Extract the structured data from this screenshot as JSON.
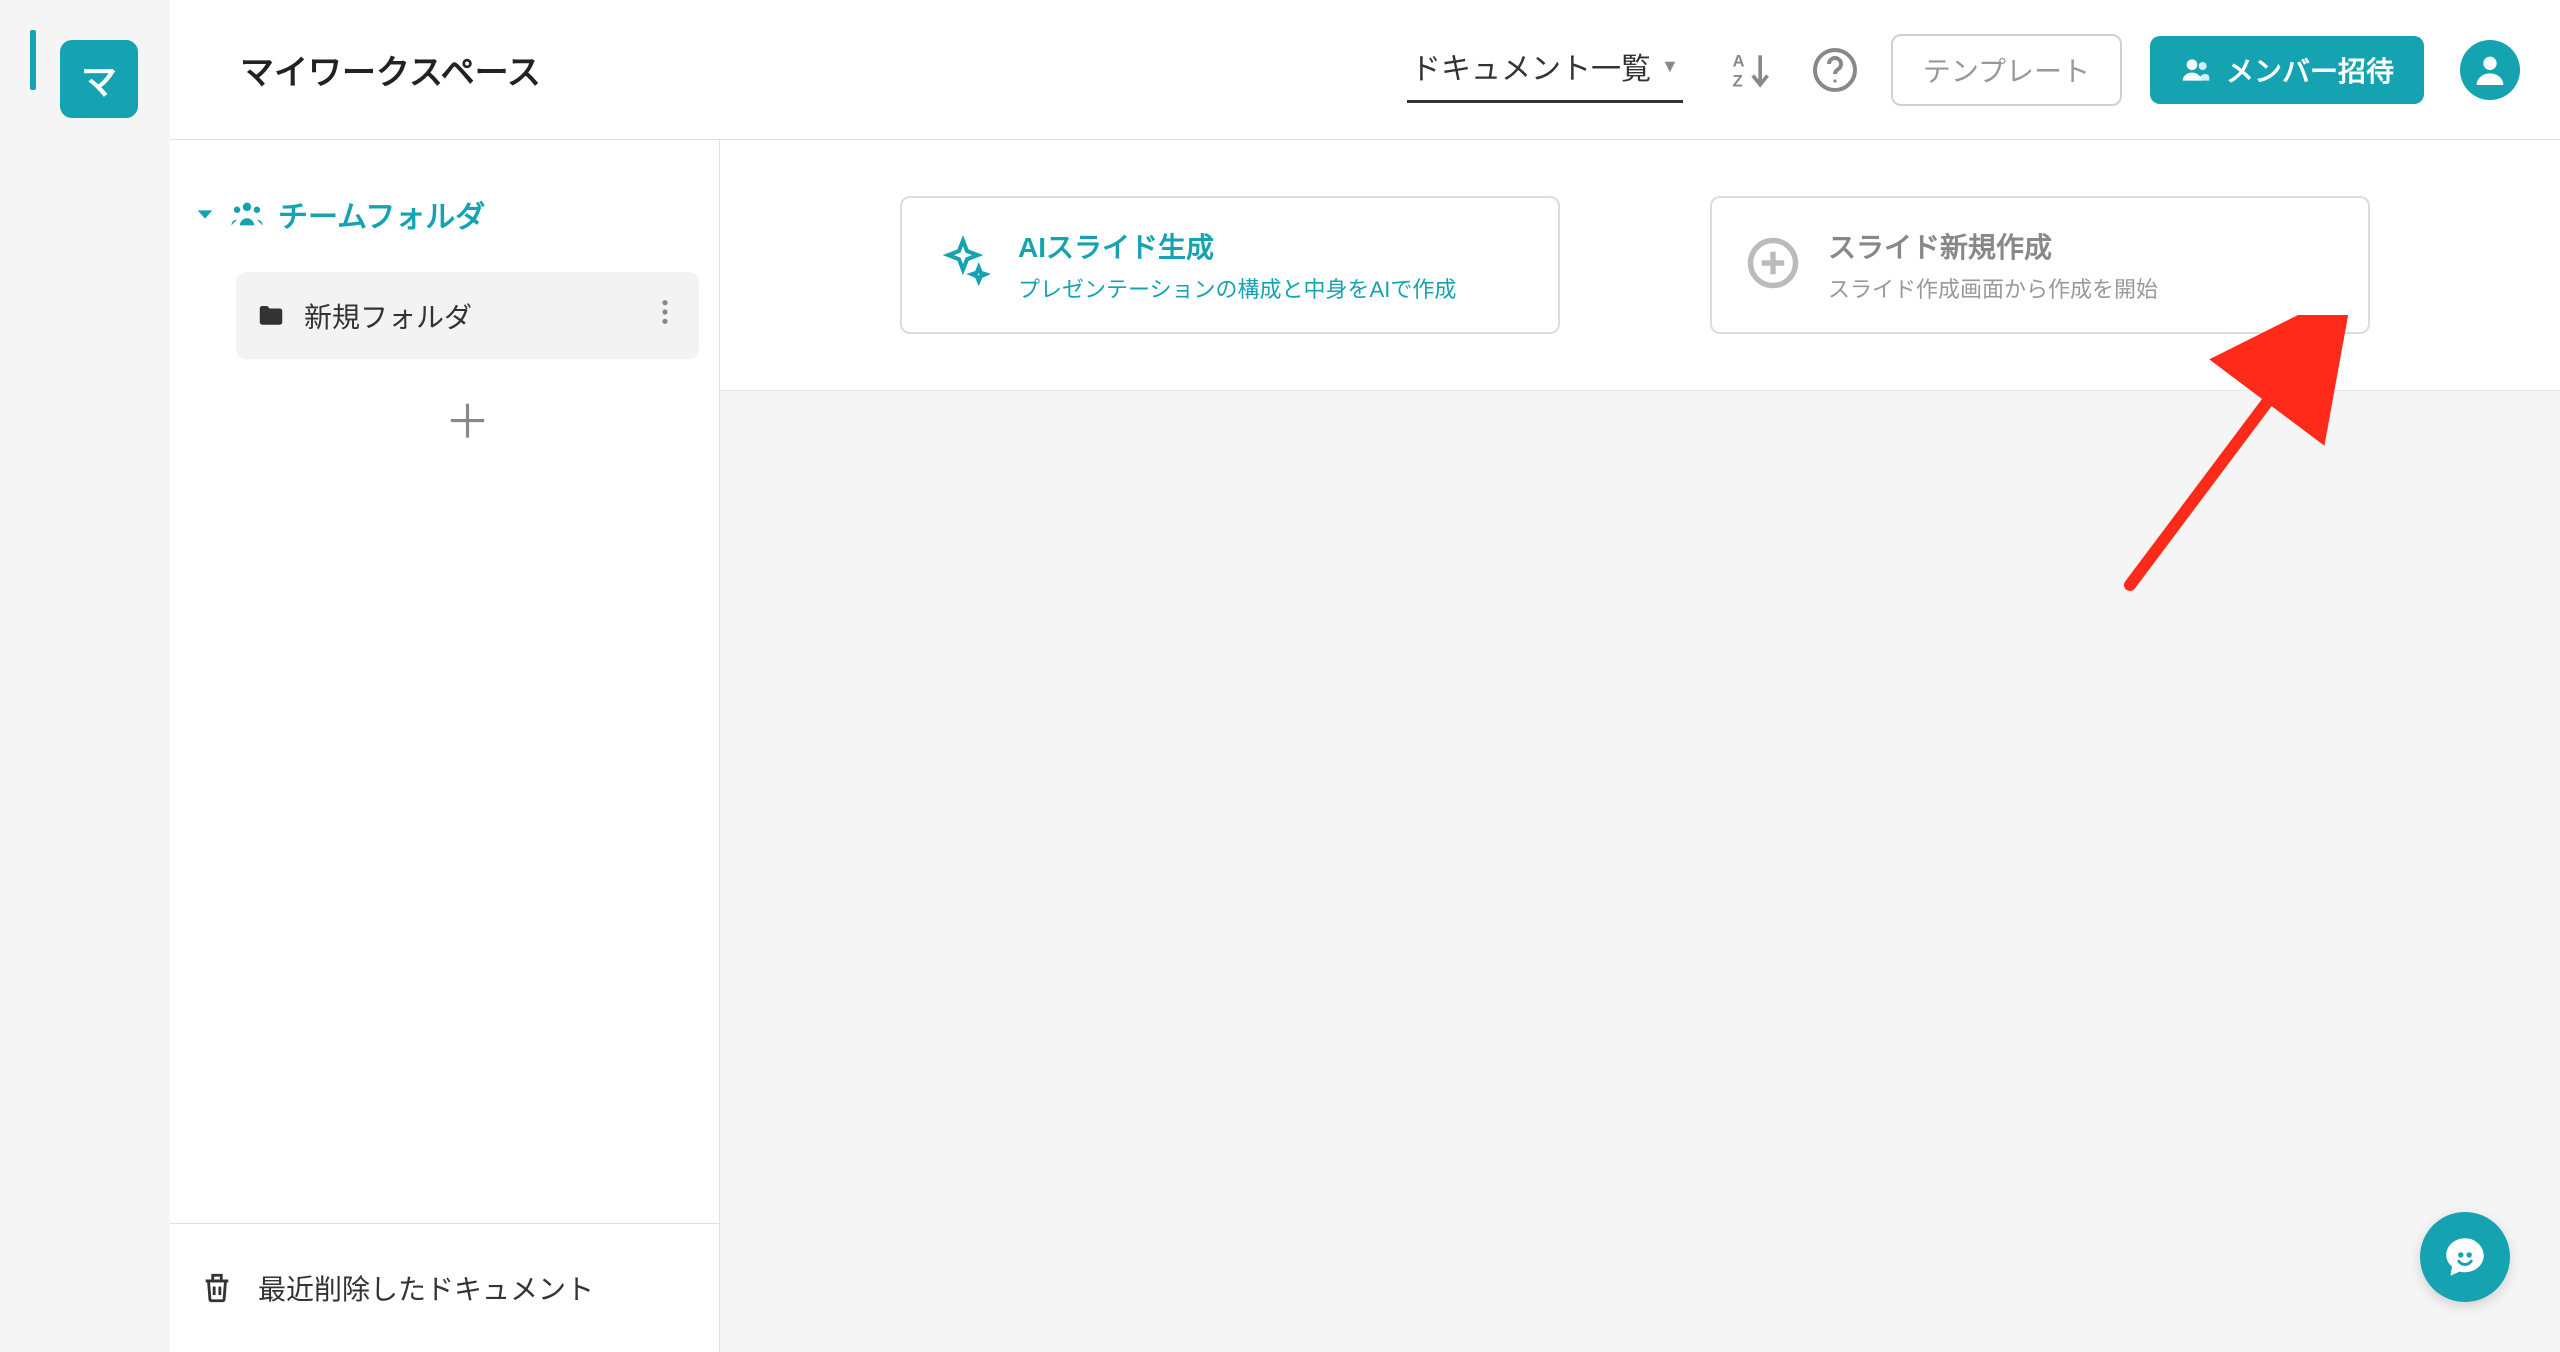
{
  "leftRail": {
    "workspace_badge_text": "マ"
  },
  "topbar": {
    "page_title": "マイワークスペース",
    "document_list_label": "ドキュメント一覧",
    "template_button_label": "テンプレート",
    "invite_button_label": "メンバー招待"
  },
  "sidebar": {
    "team_folder_label": "チームフォルダ",
    "folders": [
      {
        "name": "新規フォルダ"
      }
    ],
    "trash_label": "最近削除したドキュメント"
  },
  "cards": {
    "ai": {
      "title": "AIスライド生成",
      "subtitle": "プレゼンテーションの構成と中身をAIで作成"
    },
    "new": {
      "title": "スライド新規作成",
      "subtitle": "スライド作成画面から作成を開始"
    }
  }
}
